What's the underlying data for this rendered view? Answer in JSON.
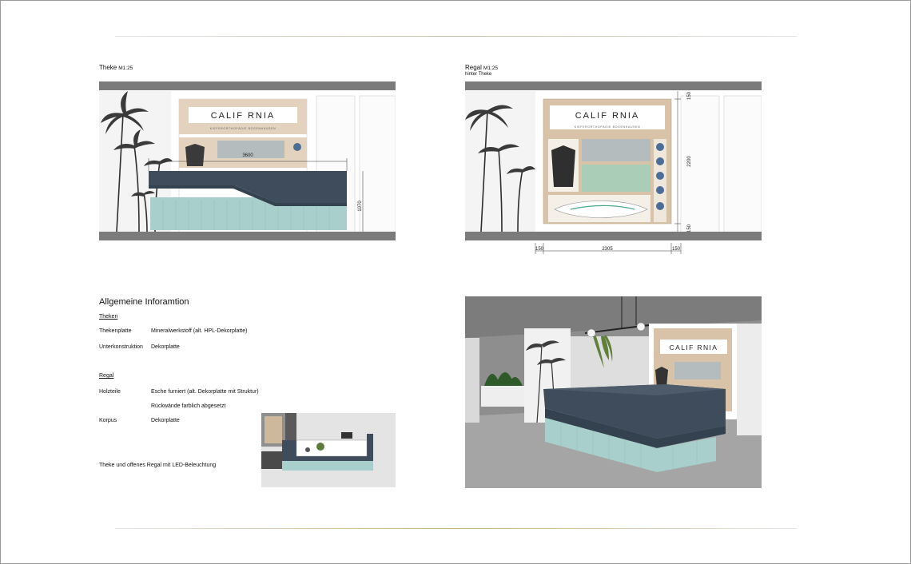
{
  "front_view": {
    "title": "Theke",
    "scale": "M1:25",
    "dim_width": "3600",
    "dim_height": "1070"
  },
  "shelf_view": {
    "title": "Regal",
    "scale": "M1:25",
    "subtitle": "hinter Theke",
    "dim_top": "150",
    "dim_height": "2200",
    "dim_bottom": "150",
    "dim_left": "150",
    "dim_width": "2305",
    "dim_right": "150"
  },
  "signage": {
    "brand": "CALIF RNIA",
    "tagline": "KIEFERORTHOPÄDIE BOGENHAUSEN"
  },
  "info": {
    "heading": "Allgemeine Inforamtion",
    "theken_heading": "Theken",
    "thekenplatte_label": "Thekenplatte",
    "thekenplatte_value": "Mineralwerkstoff (alt. HPL-Dekorplatte)",
    "unterkonstruktion_label": "Unterkonstruktion",
    "unterkonstruktion_value": "Dekorplatte",
    "regal_heading": "Regal",
    "holzteile_label": "Holzteile",
    "holzteile_value": "Esche furniert (alt. Dekorplatte mit Struktur)",
    "rueckwaende_value": "Rückwände farblich abgesetzt",
    "korpus_label": "Korpus",
    "korpus_value": "Dekorplatte",
    "note": "Theke und offenes Regal mit LED-Beleuchtung"
  },
  "colors": {
    "counter_top": "#3f4c5b",
    "counter_base": "#a8cfcb",
    "wood": "#d8c3a8",
    "slab": "#7b7b7b",
    "green_panel": "#a9cdb6",
    "grey_panel": "#b4bcbd"
  }
}
